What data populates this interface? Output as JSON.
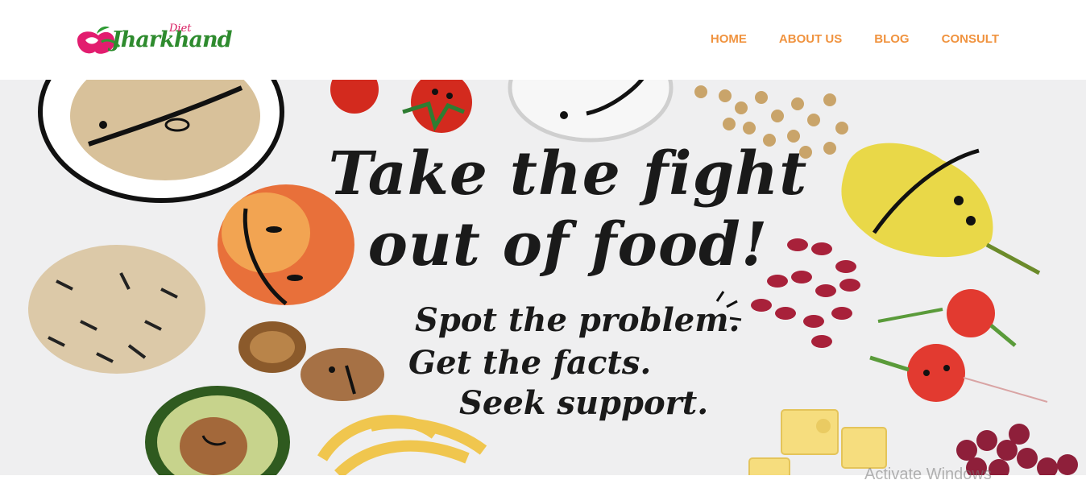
{
  "brand": {
    "name": "Jharkhand",
    "tag": "Diet"
  },
  "nav": {
    "items": [
      {
        "label": "HOME"
      },
      {
        "label": "ABOUT US"
      },
      {
        "label": "BLOG"
      },
      {
        "label": "CONSULT"
      }
    ]
  },
  "hero": {
    "line1": "Take the fight",
    "line2": "out of food!",
    "sub1": "Spot the problem.",
    "sub2": "Get the facts.",
    "sub3": "Seek support."
  },
  "watermark": "Activate Windows",
  "colors": {
    "nav": "#f0933f",
    "logo_green": "#2e8b2e",
    "logo_pink": "#d81b60"
  }
}
